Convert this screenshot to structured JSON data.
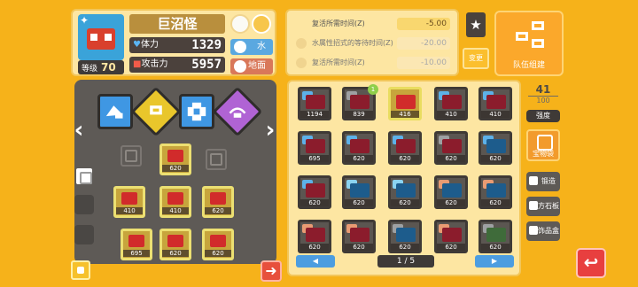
{
  "hero": {
    "name": "巨沼怪",
    "level_label": "等级",
    "level": "70",
    "hp_label": "体力",
    "hp": "1329",
    "atk_label": "攻击力",
    "atk": "5957",
    "types": [
      "水",
      "地面"
    ]
  },
  "bonuses": [
    {
      "label": "复活所需时间(Z)",
      "value": "-5.00",
      "active": true
    },
    {
      "label": "水属性招式的等待时间(Z)",
      "value": "-20.00",
      "active": false
    },
    {
      "label": "复活所需时间(Z)",
      "value": "-10.00",
      "active": false
    }
  ],
  "buttons": {
    "apply": "变更",
    "team": "队伍组建",
    "strength": "强度",
    "pouch": "宝物袋",
    "craft": "锻造",
    "stone": "方石板",
    "itembox": "饰品盒"
  },
  "formation": {
    "top_slot": "620",
    "row2": [
      "410",
      "410",
      "620"
    ],
    "row3": [
      "695",
      "620",
      "620"
    ]
  },
  "box": {
    "rows": [
      [
        "1194",
        "839",
        "416",
        "410",
        "410"
      ],
      [
        "695",
        "620",
        "620",
        "620",
        "620"
      ],
      [
        "620",
        "620",
        "620",
        "620",
        "620"
      ],
      [
        "620",
        "620",
        "620",
        "620",
        "620"
      ]
    ],
    "page": "1 / 5",
    "badge": "1"
  },
  "count": {
    "current": "41",
    "max": "100"
  },
  "colors": {
    "background": "#f6b21a",
    "panel": "#fde6a2",
    "dark": "#5e5a56",
    "accent_red": "#e83f3f",
    "accent_blue": "#4c9de0"
  }
}
